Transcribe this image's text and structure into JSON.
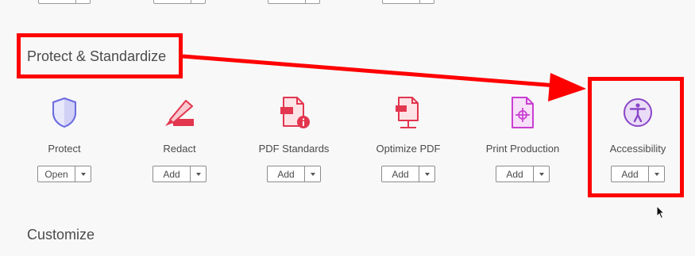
{
  "sections": {
    "protect_title": "Protect & Standardize",
    "customize_title": "Customize"
  },
  "tools": [
    {
      "label": "Protect",
      "button": "Open",
      "icon": "shield-icon"
    },
    {
      "label": "Redact",
      "button": "Add",
      "icon": "marker-icon"
    },
    {
      "label": "PDF Standards",
      "button": "Add",
      "icon": "pdf-standards-icon"
    },
    {
      "label": "Optimize PDF",
      "button": "Add",
      "icon": "optimize-pdf-icon"
    },
    {
      "label": "Print Production",
      "button": "Add",
      "icon": "print-production-icon"
    },
    {
      "label": "Accessibility",
      "button": "Add",
      "icon": "accessibility-icon"
    }
  ],
  "colors": {
    "highlight": "#ff0000",
    "protect_icon": "#6c6ce0",
    "redact_icon": "#e3364f",
    "standards_icon": "#e3364f",
    "print_icon": "#c93fd1",
    "accessibility_icon": "#8a46c8"
  }
}
